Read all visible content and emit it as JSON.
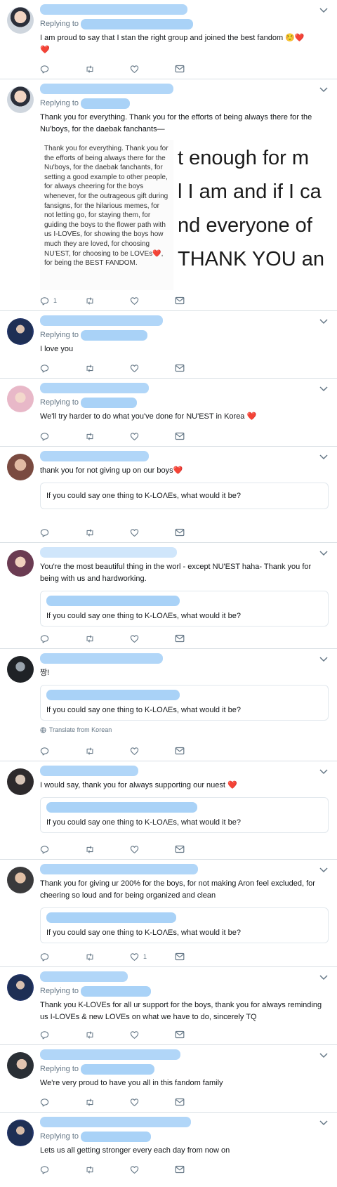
{
  "tweets": [
    {
      "replying_label": "Replying to",
      "text": "I am proud to say that I stan the right group and joined the best fandom ☺️❤️",
      "text_line2": "❤️",
      "reply_count": "",
      "like_count": ""
    },
    {
      "replying_label": "Replying to",
      "text": "Thank you for everything. Thank you for the efforts of being always there for the Nu'boys, for the daebak fanchants—",
      "image_text": "Thank you for everything. Thank you for the efforts of being always there for the Nu'boys, for the daebak fanchants, for setting a good example to other people, for always cheering for the boys whenever, for the outrageous gift during fansigns, for the hilarious memes, for not letting go, for staying them, for guiding the boys to the flower path with us I-LOVEs, for showing the boys how much they are loved, for choosing NU'EST, for choosing to be LOVEs❤️, for being the BEST FANDOM.",
      "image_big_lines": [
        "t enough for m",
        "l I am and if I ca",
        "nd everyone of",
        "THANK YOU an"
      ],
      "reply_count": "1",
      "like_count": ""
    },
    {
      "replying_label": "Replying to",
      "text": "I love you"
    },
    {
      "replying_label": "Replying to",
      "text": "We'll try harder to do what you've done for NU'EST in Korea ❤️"
    },
    {
      "text": "thank you for not giving up on our boys❤️",
      "quote_text": "If you could say one thing to K-LOΛEs, what would it be?"
    },
    {
      "text": "You're the most beautiful thing in the worl - except NU'EST haha- Thank you for being with us and hardworking.",
      "quote_text": "If you could say one thing to K-LOΛEs, what would it be?"
    },
    {
      "text": "짱!",
      "quote_text": "If you could say one thing to K-LOΛEs, what would it be?",
      "translate": "Translate from Korean"
    },
    {
      "text": "I would say, thank you for always supporting our nuest ❤️",
      "quote_text": "If you could say one thing to K-LOΛEs, what would it be?"
    },
    {
      "text": "Thank you for giving ur 200% for the boys,  for not making Aron feel excluded, for cheering so loud and for being organized and clean",
      "quote_text": "If you could say one thing to K-LOΛEs, what would it be?",
      "like_count": "1"
    },
    {
      "replying_label": "Replying to",
      "text": "Thank you K-LOVEs for all ur support for the boys, thank you for always reminding us I-LOVEs & new LOVEs on what we have to do, sincerely TQ"
    },
    {
      "replying_label": "Replying to",
      "text": "We're very proud to have you all in this fandom family"
    },
    {
      "replying_label": "Replying to",
      "text": "Lets us all getting stronger every each day from now on"
    }
  ],
  "colors": {
    "blur": "#a9d2f7",
    "icon": "#657786",
    "border": "#d9dfe4",
    "heart": "#e0245e"
  },
  "icons": [
    "reply-icon",
    "retweet-icon",
    "like-icon",
    "mail-icon",
    "chevron-down-icon",
    "globe-icon"
  ]
}
